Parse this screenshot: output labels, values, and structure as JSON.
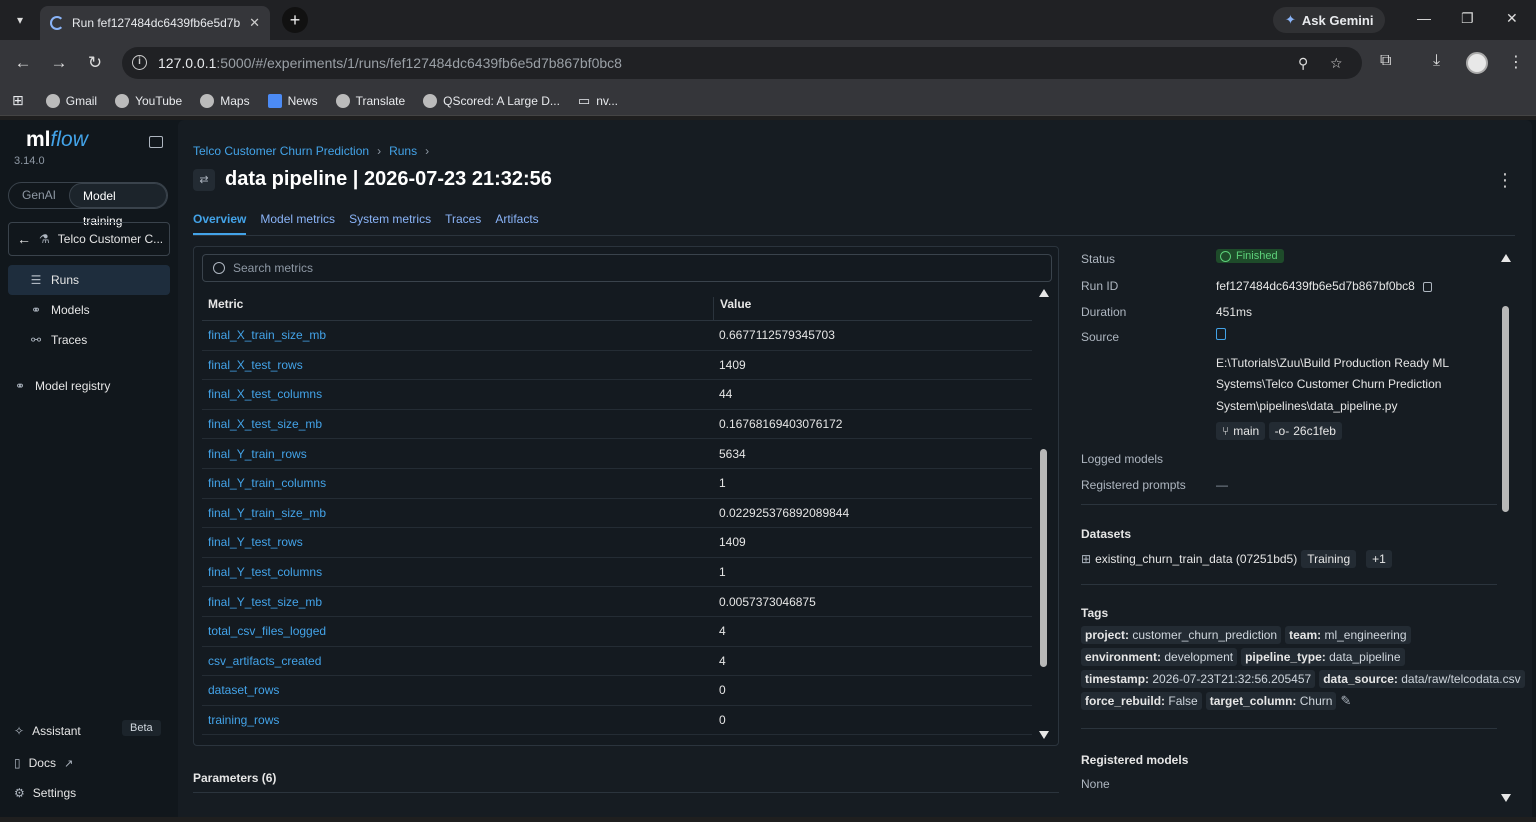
{
  "browser": {
    "tab_title": "Run fef127484dc6439fb6e5d7b",
    "ask_gemini": "Ask Gemini",
    "url_host": "127.0.0.1",
    "url_path": ":5000/#/experiments/1/runs/fef127484dc6439fb6e5d7b867bf0bc8",
    "bookmarks": [
      {
        "label": "Gmail"
      },
      {
        "label": "YouTube"
      },
      {
        "label": "Maps"
      },
      {
        "label": "News"
      },
      {
        "label": "Translate"
      },
      {
        "label": "QScored: A Large D..."
      },
      {
        "label": "nv..."
      }
    ]
  },
  "sidebar": {
    "logo_ml": "ml",
    "logo_flow": "flow",
    "version": "3.14.0",
    "segment": {
      "genai": "GenAI",
      "training": "Model training"
    },
    "experiment": "Telco Customer C...",
    "items": [
      {
        "label": "Runs",
        "icon": "list-icon"
      },
      {
        "label": "Models",
        "icon": "models-icon"
      },
      {
        "label": "Traces",
        "icon": "traces-icon"
      },
      {
        "label": "Model registry",
        "icon": "registry-icon"
      }
    ],
    "assistant": "Assistant",
    "beta": "Beta",
    "docs": "Docs",
    "settings": "Settings"
  },
  "header": {
    "breadcrumb": [
      "Telco Customer Churn Prediction",
      "Runs"
    ],
    "title": "data pipeline | 2026-07-23 21:32:56",
    "tabs": [
      "Overview",
      "Model metrics",
      "System metrics",
      "Traces",
      "Artifacts"
    ]
  },
  "metrics": {
    "search_placeholder": "Search metrics",
    "col_metric": "Metric",
    "col_value": "Value",
    "rows": [
      {
        "metric": "final_X_train_size_mb",
        "value": "0.6677112579345703"
      },
      {
        "metric": "final_X_test_rows",
        "value": "1409"
      },
      {
        "metric": "final_X_test_columns",
        "value": "44"
      },
      {
        "metric": "final_X_test_size_mb",
        "value": "0.16768169403076172"
      },
      {
        "metric": "final_Y_train_rows",
        "value": "5634"
      },
      {
        "metric": "final_Y_train_columns",
        "value": "1"
      },
      {
        "metric": "final_Y_train_size_mb",
        "value": "0.022925376892089844"
      },
      {
        "metric": "final_Y_test_rows",
        "value": "1409"
      },
      {
        "metric": "final_Y_test_columns",
        "value": "1"
      },
      {
        "metric": "final_Y_test_size_mb",
        "value": "0.0057373046875"
      },
      {
        "metric": "total_csv_files_logged",
        "value": "4"
      },
      {
        "metric": "csv_artifacts_created",
        "value": "4"
      },
      {
        "metric": "dataset_rows",
        "value": "0"
      },
      {
        "metric": "training_rows",
        "value": "0"
      }
    ]
  },
  "parameters_label": "Parameters (6)",
  "details": {
    "status_label": "Status",
    "status_value": "Finished",
    "run_id_label": "Run ID",
    "run_id": "fef127484dc6439fb6e5d7b867bf0bc8",
    "duration_label": "Duration",
    "duration": "451ms",
    "source_label": "Source",
    "source_path_1": "E:\\Tutorials\\Zuu\\Build Production Ready ML",
    "source_path_2": "Systems\\Telco Customer Churn Prediction",
    "source_path_3": "System\\pipelines\\data_pipeline.py",
    "branch": "main",
    "commit": "26c1feb",
    "logged_models_label": "Logged models",
    "registered_prompts_label": "Registered prompts",
    "registered_prompts_value": "—",
    "datasets_label": "Datasets",
    "dataset_name": "existing_churn_train_data (07251bd5)",
    "dataset_context": "Training",
    "dataset_more": "+1",
    "tags_label": "Tags",
    "tags": [
      {
        "key": "project",
        "value": "customer_churn_prediction"
      },
      {
        "key": "team",
        "value": "ml_engineering"
      },
      {
        "key": "environment",
        "value": "development"
      },
      {
        "key": "pipeline_type",
        "value": "data_pipeline"
      },
      {
        "key": "timestamp",
        "value": "2026-07-23T21:32:56.205457"
      },
      {
        "key": "data_source",
        "value": "data/raw/telcodata.csv"
      },
      {
        "key": "force_rebuild",
        "value": "False"
      },
      {
        "key": "target_column",
        "value": "Churn"
      }
    ],
    "registered_models_label": "Registered models",
    "registered_models_value": "None"
  },
  "colors": {
    "accent": "#43a3e8",
    "status_ok": "#5dd07a"
  }
}
